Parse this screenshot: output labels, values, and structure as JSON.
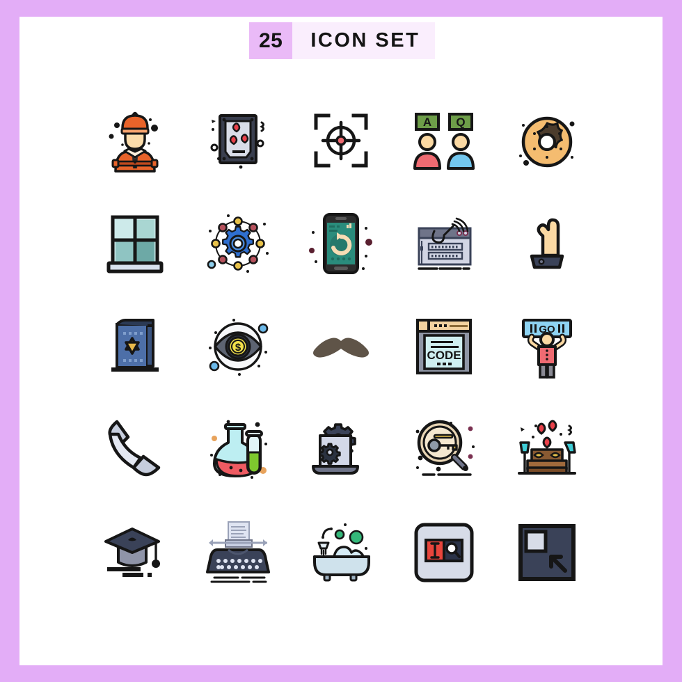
{
  "header": {
    "count": "25",
    "title": "ICON SET",
    "badge_bg": "#eabaf7",
    "title_bg": "#faeefd",
    "text_color": "#141414"
  },
  "frame": {
    "border_color": "#e3adf7",
    "page_bg": "#ffffff"
  },
  "grid": {
    "columns": 5,
    "rows": 5,
    "total": 25
  },
  "icons": [
    {
      "index": 1,
      "row": 1,
      "col": 1,
      "name": "construction-worker-icon",
      "label": "Construction Worker",
      "colors": [
        "#e8632a",
        "#f9d9a8",
        "#161616"
      ]
    },
    {
      "index": 2,
      "row": 1,
      "col": 2,
      "name": "love-photo-frame-icon",
      "label": "Love Photo Frame",
      "colors": [
        "#c9cedd",
        "#e8414a",
        "#161616"
      ]
    },
    {
      "index": 3,
      "row": 1,
      "col": 3,
      "name": "focus-target-icon",
      "label": "Focus Target",
      "colors": [
        "#161616",
        "#ef6b72"
      ]
    },
    {
      "index": 4,
      "row": 1,
      "col": 4,
      "name": "question-answer-people-icon",
      "label": "Question Answer",
      "colors": [
        "#6e9e49",
        "#ef6b72",
        "#73c7ef"
      ]
    },
    {
      "index": 5,
      "row": 1,
      "col": 5,
      "name": "donut-icon",
      "label": "Donut",
      "colors": [
        "#f4bc70",
        "#4c3c2c",
        "#161616"
      ]
    },
    {
      "index": 6,
      "row": 2,
      "col": 1,
      "name": "window-icon",
      "label": "Window",
      "colors": [
        "#cdeaea",
        "#78b4b4",
        "#161616"
      ]
    },
    {
      "index": 7,
      "row": 2,
      "col": 2,
      "name": "settings-network-icon",
      "label": "Settings Network",
      "colors": [
        "#2f6fd0",
        "#e8c24a",
        "#b5515c"
      ]
    },
    {
      "index": 8,
      "row": 2,
      "col": 3,
      "name": "mobile-restore-icon",
      "label": "Mobile Restore",
      "colors": [
        "#2a8c7c",
        "#f7dcb4",
        "#2c2c2c"
      ]
    },
    {
      "index": 9,
      "row": 2,
      "col": 4,
      "name": "phishing-website-icon",
      "label": "Phishing Website",
      "colors": [
        "#d2d5e4",
        "#6f7489",
        "#161616"
      ]
    },
    {
      "index": 10,
      "row": 2,
      "col": 5,
      "name": "raised-hand-icon",
      "label": "Raised Hand",
      "colors": [
        "#f9d9a8",
        "#3a4258",
        "#161616"
      ]
    },
    {
      "index": 11,
      "row": 3,
      "col": 1,
      "name": "torah-book-icon",
      "label": "Torah Book",
      "colors": [
        "#4d6fa8",
        "#e8b84a",
        "#2b3a55"
      ]
    },
    {
      "index": 12,
      "row": 3,
      "col": 2,
      "name": "money-eye-icon",
      "label": "Money Vision Eye",
      "colors": [
        "#5d6472",
        "#f2e04a",
        "#6bb8e8"
      ]
    },
    {
      "index": 13,
      "row": 3,
      "col": 3,
      "name": "moustache-icon",
      "label": "Moustache",
      "colors": [
        "#5f5448"
      ]
    },
    {
      "index": 14,
      "row": 3,
      "col": 4,
      "name": "code-window-icon",
      "label": "Code Window",
      "colors": [
        "#cfeff0",
        "#f2d2a0",
        "#161616"
      ]
    },
    {
      "index": 15,
      "row": 3,
      "col": 5,
      "name": "go-sign-fan-icon",
      "label": "Go Sign Fan",
      "colors": [
        "#8ed3f2",
        "#ef6b72",
        "#8a8a94"
      ]
    },
    {
      "index": 16,
      "row": 4,
      "col": 1,
      "name": "phone-receiver-icon",
      "label": "Phone Receiver",
      "colors": [
        "#d7dce8",
        "#161616"
      ]
    },
    {
      "index": 17,
      "row": 4,
      "col": 2,
      "name": "chemistry-flask-icon",
      "label": "Chemistry Flask",
      "colors": [
        "#bdeef2",
        "#ef5b62",
        "#7ec82e"
      ]
    },
    {
      "index": 18,
      "row": 4,
      "col": 3,
      "name": "laptop-settings-icon",
      "label": "Laptop Settings",
      "colors": [
        "#d3d8e8",
        "#3a4258",
        "#161616"
      ]
    },
    {
      "index": 19,
      "row": 4,
      "col": 4,
      "name": "keyword-search-icon",
      "label": "Keyword Search",
      "colors": [
        "#e8d5b4",
        "#8f9aa8",
        "#161616"
      ]
    },
    {
      "index": 20,
      "row": 4,
      "col": 5,
      "name": "romantic-bedroom-icon",
      "label": "Romantic Bedroom",
      "colors": [
        "#8a5a32",
        "#e8414a",
        "#3ecdd6"
      ]
    },
    {
      "index": 21,
      "row": 5,
      "col": 1,
      "name": "graduation-cap-icon",
      "label": "Graduation Cap",
      "colors": [
        "#8f94a8",
        "#3a4258",
        "#161616"
      ]
    },
    {
      "index": 22,
      "row": 5,
      "col": 2,
      "name": "typewriter-icon",
      "label": "Typewriter",
      "colors": [
        "#3a4258",
        "#dfe4f2",
        "#161616"
      ]
    },
    {
      "index": 23,
      "row": 5,
      "col": 3,
      "name": "bathtub-icon",
      "label": "Bathtub",
      "colors": [
        "#cfe2ec",
        "#34b87a",
        "#161616"
      ]
    },
    {
      "index": 24,
      "row": 5,
      "col": 4,
      "name": "text-search-tool-icon",
      "label": "Text Search Tool",
      "colors": [
        "#e8453c",
        "#2b3348",
        "#d7dce8"
      ]
    },
    {
      "index": 25,
      "row": 5,
      "col": 5,
      "name": "restore-window-icon",
      "label": "Restore Window",
      "colors": [
        "#3a4258",
        "#d7dce8",
        "#161616"
      ]
    }
  ]
}
